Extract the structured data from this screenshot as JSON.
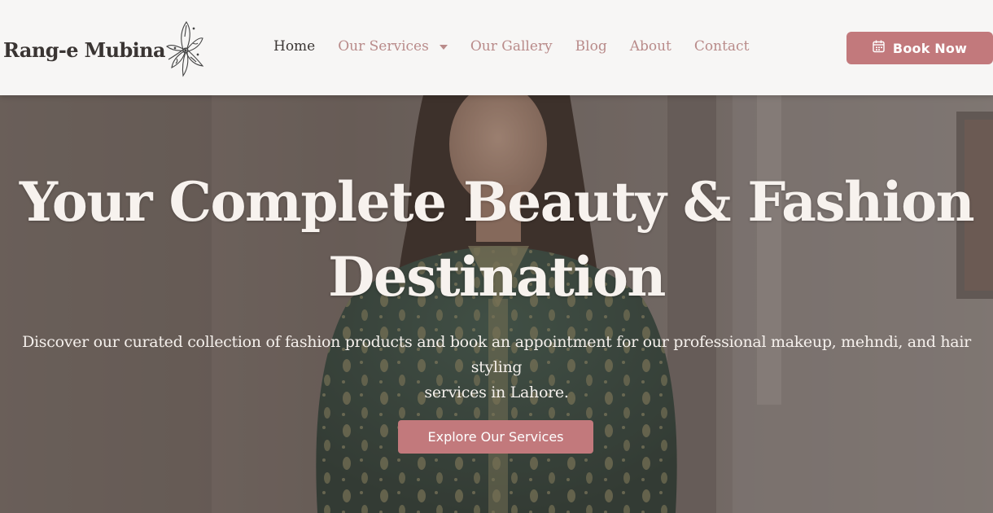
{
  "brand": {
    "name": "Rang-e Mubina",
    "logo_icon": "henna-flower-icon"
  },
  "nav": {
    "items": [
      {
        "label": "Home",
        "active": true
      },
      {
        "label": "Our Services",
        "has_dropdown": true
      },
      {
        "label": "Our Gallery"
      },
      {
        "label": "Blog"
      },
      {
        "label": "About"
      },
      {
        "label": "Contact"
      }
    ]
  },
  "book_button": {
    "label": "Book Now",
    "icon": "calendar-icon"
  },
  "hero": {
    "title_line1": "Your Complete Beauty & Fashion",
    "title_line2": "Destination",
    "subtitle_line1": "Discover our curated collection of fashion products and book an appointment for our professional makeup, mehndi, and hair styling",
    "subtitle_line2": "services in Lahore.",
    "cta_label": "Explore Our Services"
  },
  "colors": {
    "accent": "#c2797c",
    "nav_link": "#b98b8a",
    "nav_active": "#3b3634",
    "header_bg": "#f7f6f5"
  }
}
